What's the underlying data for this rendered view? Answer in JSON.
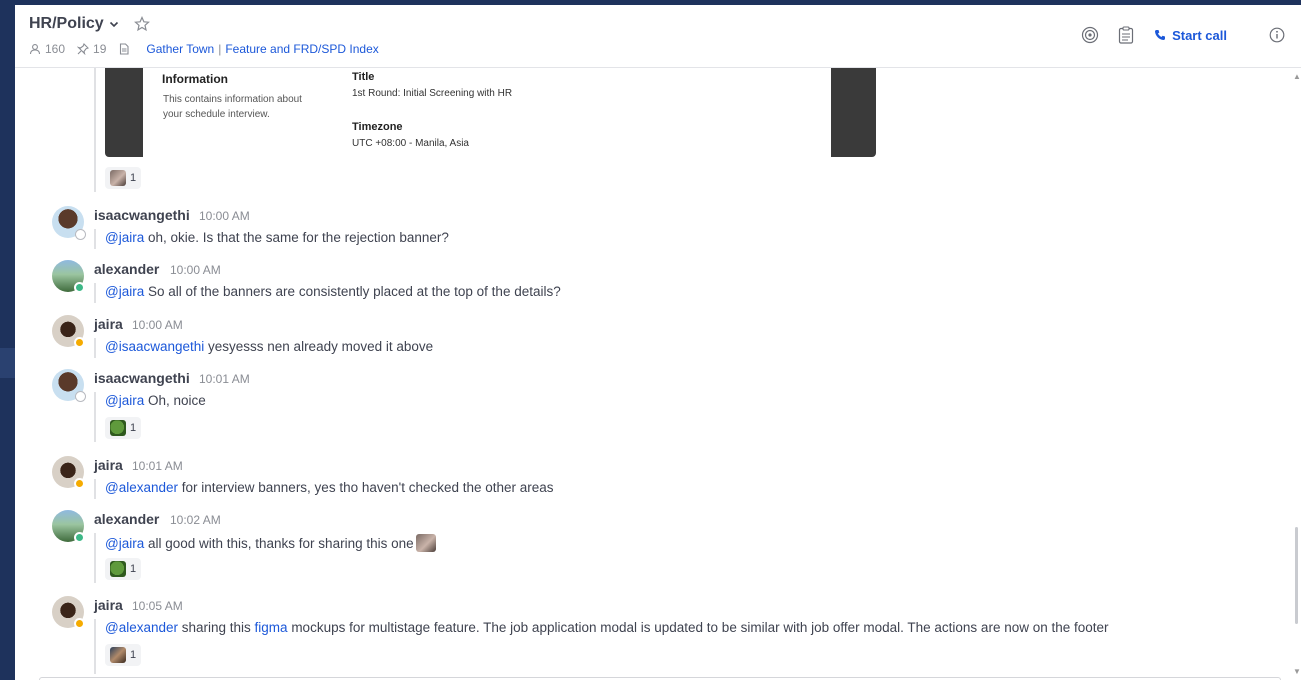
{
  "channel": {
    "name": "HR/Policy",
    "members": "160",
    "pinned": "19",
    "bookmark_1": "Gather Town",
    "bookmark_sep": "|",
    "bookmark_2": "Feature and FRD/SPD Index"
  },
  "header_actions": {
    "start_call": "Start call"
  },
  "preview": {
    "heading": "Information",
    "description": "This contains information about your schedule interview.",
    "label_1": "Title",
    "value_1": "1st Round: Initial Screening with HR",
    "label_2": "Timezone",
    "value_2": "UTC +08:00 - Manila, Asia"
  },
  "reactions": {
    "r0": "1",
    "r1": "1",
    "r2": "1",
    "r3": "1"
  },
  "messages": [
    {
      "user": "isaacwangethi",
      "time": "10:00 AM",
      "mention": "@jaira",
      "text": " oh, okie. Is that the same for the rejection banner?"
    },
    {
      "user": "alexander",
      "time": "10:00 AM",
      "mention": "@jaira",
      "text": " So all of the banners are consistently placed at  the top of the details?"
    },
    {
      "user": "jaira",
      "time": "10:00 AM",
      "mention": "@isaacwangethi",
      "text": " yesyesss nen already moved it above"
    },
    {
      "user": "isaacwangethi",
      "time": "10:01 AM",
      "mention": "@jaira",
      "text": " Oh, noice"
    },
    {
      "user": "jaira",
      "time": "10:01 AM",
      "mention": "@alexander",
      "text": " for interview banners, yes tho haven't checked the other areas"
    },
    {
      "user": "alexander",
      "time": "10:02 AM",
      "mention": "@jaira",
      "text": " all good with this, thanks for sharing this one"
    },
    {
      "user": "jaira",
      "time": "10:05 AM",
      "mention": "@alexander",
      "text_a": " sharing this ",
      "link": "figma",
      "text_b": " mockups for multistage feature. The job application modal is updated to be similar with job offer modal. The actions are now on the footer"
    }
  ],
  "colors": {
    "sidebar": "#1e325c",
    "accent": "#1c58d9",
    "online": "#3db887",
    "dnd": "#f5ab00"
  }
}
